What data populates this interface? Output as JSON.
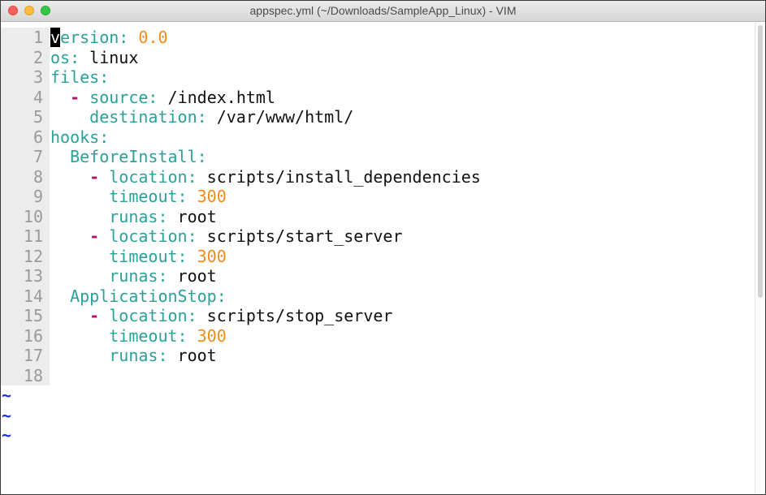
{
  "window": {
    "title": "appspec.yml (~/Downloads/SampleApp_Linux) - VIM"
  },
  "editor": {
    "lines": [
      {
        "n": "1",
        "indent": "",
        "dash": false,
        "key": "ersion:",
        "value": " 0.0",
        "value_type": "num",
        "cursor_char": "v"
      },
      {
        "n": "2",
        "indent": "",
        "dash": false,
        "key": "os:",
        "value": " linux",
        "value_type": "str"
      },
      {
        "n": "3",
        "indent": "",
        "dash": false,
        "key": "files:",
        "value": "",
        "value_type": "str"
      },
      {
        "n": "4",
        "indent": "  ",
        "dash": true,
        "key": "source:",
        "value": " /index.html",
        "value_type": "str"
      },
      {
        "n": "5",
        "indent": "    ",
        "dash": false,
        "key": "destination:",
        "value": " /var/www/html/",
        "value_type": "str"
      },
      {
        "n": "6",
        "indent": "",
        "dash": false,
        "key": "hooks:",
        "value": "",
        "value_type": "str"
      },
      {
        "n": "7",
        "indent": "  ",
        "dash": false,
        "key": "BeforeInstall:",
        "value": "",
        "value_type": "str"
      },
      {
        "n": "8",
        "indent": "    ",
        "dash": true,
        "key": "location:",
        "value": " scripts/install_dependencies",
        "value_type": "str"
      },
      {
        "n": "9",
        "indent": "      ",
        "dash": false,
        "key": "timeout:",
        "value": " 300",
        "value_type": "num"
      },
      {
        "n": "10",
        "indent": "      ",
        "dash": false,
        "key": "runas:",
        "value": " root",
        "value_type": "str"
      },
      {
        "n": "11",
        "indent": "    ",
        "dash": true,
        "key": "location:",
        "value": " scripts/start_server",
        "value_type": "str"
      },
      {
        "n": "12",
        "indent": "      ",
        "dash": false,
        "key": "timeout:",
        "value": " 300",
        "value_type": "num"
      },
      {
        "n": "13",
        "indent": "      ",
        "dash": false,
        "key": "runas:",
        "value": " root",
        "value_type": "str"
      },
      {
        "n": "14",
        "indent": "  ",
        "dash": false,
        "key": "ApplicationStop:",
        "value": "",
        "value_type": "str"
      },
      {
        "n": "15",
        "indent": "    ",
        "dash": true,
        "key": "location:",
        "value": " scripts/stop_server",
        "value_type": "str"
      },
      {
        "n": "16",
        "indent": "      ",
        "dash": false,
        "key": "timeout:",
        "value": " 300",
        "value_type": "num"
      },
      {
        "n": "17",
        "indent": "      ",
        "dash": false,
        "key": "runas:",
        "value": " root",
        "value_type": "str"
      },
      {
        "n": "18",
        "indent": "",
        "dash": false,
        "key": "",
        "value": "",
        "value_type": "str"
      }
    ],
    "empty_line_markers": [
      "~",
      "~",
      "~"
    ]
  },
  "colors": {
    "key": "#2aa198",
    "dash": "#b0126c",
    "number": "#f08c1a",
    "tilde": "#1f2dd8",
    "line_number": "#9a9a9a"
  }
}
